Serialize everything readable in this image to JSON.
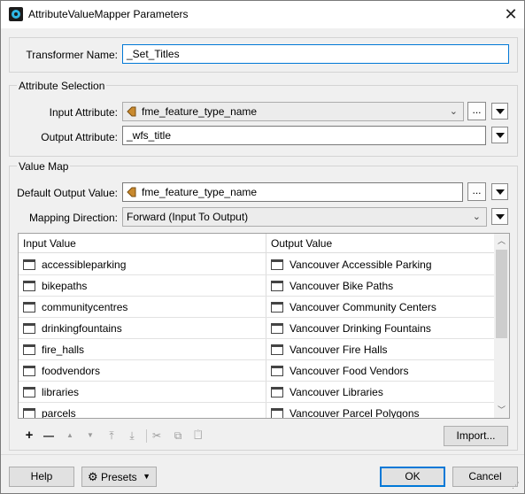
{
  "window": {
    "title": "AttributeValueMapper Parameters",
    "close_symbol": "✕"
  },
  "transformer": {
    "label": "Transformer Name:",
    "value": "_Set_Titles"
  },
  "attribute_selection": {
    "group_label": "Attribute Selection",
    "input_label": "Input Attribute:",
    "input_value": "fme_feature_type_name",
    "output_label": "Output Attribute:",
    "output_value": "_wfs_title",
    "ellipsis": "..."
  },
  "value_map": {
    "group_label": "Value Map",
    "default_label": "Default Output Value:",
    "default_value": "fme_feature_type_name",
    "direction_label": "Mapping Direction:",
    "direction_value": "Forward (Input To Output)",
    "ellipsis": "...",
    "columns": [
      "Input Value",
      "Output Value"
    ],
    "rows": [
      {
        "input": "accessibleparking",
        "output": "Vancouver Accessible Parking"
      },
      {
        "input": "bikepaths",
        "output": "Vancouver Bike Paths"
      },
      {
        "input": "communitycentres",
        "output": "Vancouver Community Centers"
      },
      {
        "input": "drinkingfountains",
        "output": "Vancouver Drinking Fountains"
      },
      {
        "input": "fire_halls",
        "output": "Vancouver Fire Halls"
      },
      {
        "input": "foodvendors",
        "output": "Vancouver Food Vendors"
      },
      {
        "input": "libraries",
        "output": "Vancouver Libraries"
      },
      {
        "input": "parcels",
        "output": "Vancouver Parcel Polygons"
      }
    ]
  },
  "toolbar": {
    "add": "+",
    "remove": "—",
    "move_up": "▲",
    "move_down": "▼",
    "move_top": "⤒",
    "move_bottom": "⤓",
    "cut": "✂",
    "copy": "⧉",
    "paste": "📋",
    "import_label": "Import..."
  },
  "footer": {
    "help_label": "Help",
    "presets_label": "Presets",
    "ok_label": "OK",
    "cancel_label": "Cancel"
  },
  "colors": {
    "focus_border": "#0078d7",
    "attribute_icon": "#c98a2e"
  }
}
